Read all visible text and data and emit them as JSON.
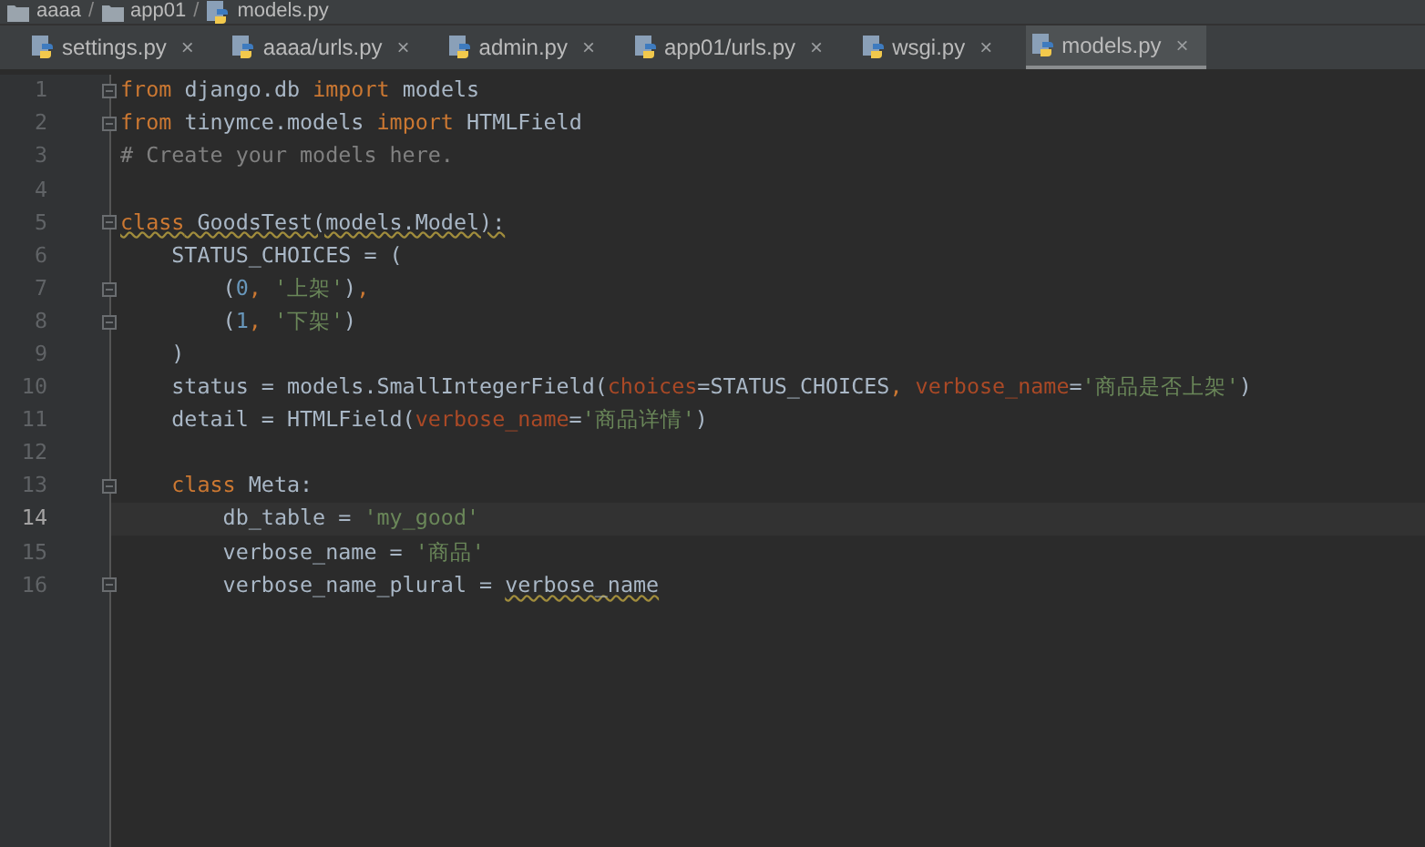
{
  "breadcrumbs": [
    {
      "label": "aaaa"
    },
    {
      "label": "app01"
    },
    {
      "label": "models.py"
    }
  ],
  "breadcrumb_separator": "/",
  "tabs": [
    {
      "label": "settings.py",
      "selected": false
    },
    {
      "label": "aaaa/urls.py",
      "selected": false
    },
    {
      "label": "admin.py",
      "selected": false
    },
    {
      "label": "app01/urls.py",
      "selected": false
    },
    {
      "label": "wsgi.py",
      "selected": false
    },
    {
      "label": "models.py",
      "selected": true
    }
  ],
  "close_glyph": "×",
  "lines": [
    {
      "number": "1",
      "current": false,
      "fold": true,
      "tokens": [
        {
          "text": "from",
          "kind": "keyword"
        },
        {
          "text": " django.db ",
          "kind": "plain"
        },
        {
          "text": "import",
          "kind": "keyword"
        },
        {
          "text": " models",
          "kind": "plain"
        }
      ]
    },
    {
      "number": "2",
      "current": false,
      "fold": true,
      "tokens": [
        {
          "text": "from",
          "kind": "keyword"
        },
        {
          "text": " tinymce.models ",
          "kind": "plain"
        },
        {
          "text": "import",
          "kind": "keyword"
        },
        {
          "text": " HTMLField",
          "kind": "plain"
        }
      ]
    },
    {
      "number": "3",
      "current": false,
      "fold": false,
      "tokens": [
        {
          "text": "# Create your models here.",
          "kind": "comment"
        }
      ]
    },
    {
      "number": "4",
      "current": false,
      "fold": false
    },
    {
      "number": "5",
      "current": false,
      "fold": true,
      "tokens": [
        {
          "text": "class",
          "kind": "keyword",
          "underlined": true
        },
        {
          "text": " GoodsTest(models.Model):",
          "kind": "plain",
          "underlined": true
        }
      ]
    },
    {
      "number": "6",
      "current": false,
      "fold": false,
      "tokens": [
        {
          "text": "    STATUS_CHOICES = (",
          "kind": "plain"
        }
      ]
    },
    {
      "number": "7",
      "current": false,
      "fold": true,
      "tokens": [
        {
          "text": "        (",
          "kind": "plain"
        },
        {
          "text": "0",
          "kind": "number"
        },
        {
          "text": ", ",
          "kind": "keyword"
        },
        {
          "text": "'上架'",
          "kind": "string"
        },
        {
          "text": ")",
          "kind": "plain"
        },
        {
          "text": ",",
          "kind": "keyword"
        }
      ]
    },
    {
      "number": "8",
      "current": false,
      "fold": true,
      "tokens": [
        {
          "text": "        (",
          "kind": "plain"
        },
        {
          "text": "1",
          "kind": "number"
        },
        {
          "text": ", ",
          "kind": "keyword"
        },
        {
          "text": "'下架'",
          "kind": "string"
        },
        {
          "text": ")",
          "kind": "plain"
        }
      ]
    },
    {
      "number": "9",
      "current": false,
      "fold": false,
      "tokens": [
        {
          "text": "    )",
          "kind": "plain"
        }
      ]
    },
    {
      "number": "10",
      "current": false,
      "fold": false,
      "tokens": [
        {
          "text": "    status = models.SmallIntegerField(",
          "kind": "plain"
        },
        {
          "text": "choices",
          "kind": "param"
        },
        {
          "text": "=STATUS_CHOICES",
          "kind": "plain"
        },
        {
          "text": ", ",
          "kind": "keyword"
        },
        {
          "text": "verbose_name",
          "kind": "param"
        },
        {
          "text": "=",
          "kind": "plain"
        },
        {
          "text": "'商品是否上架'",
          "kind": "string"
        },
        {
          "text": ")",
          "kind": "plain"
        }
      ]
    },
    {
      "number": "11",
      "current": false,
      "fold": false,
      "tokens": [
        {
          "text": "    detail = HTMLField(",
          "kind": "plain"
        },
        {
          "text": "verbose_name",
          "kind": "param"
        },
        {
          "text": "=",
          "kind": "plain"
        },
        {
          "text": "'商品详情'",
          "kind": "string"
        },
        {
          "text": ")",
          "kind": "plain"
        }
      ]
    },
    {
      "number": "12",
      "current": false,
      "fold": false
    },
    {
      "number": "13",
      "current": false,
      "fold": true,
      "tokens": [
        {
          "text": "    class",
          "kind": "keyword"
        },
        {
          "text": " Meta:",
          "kind": "plain"
        }
      ]
    },
    {
      "number": "14",
      "current": true,
      "fold": false,
      "tokens": [
        {
          "text": "        db_table = ",
          "kind": "plain"
        },
        {
          "text": "'my_good'",
          "kind": "string"
        }
      ]
    },
    {
      "number": "15",
      "current": false,
      "fold": false,
      "tokens": [
        {
          "text": "        verbose_name = ",
          "kind": "plain"
        },
        {
          "text": "'商品'",
          "kind": "string"
        }
      ]
    },
    {
      "number": "16",
      "current": false,
      "fold": true,
      "tokens": [
        {
          "text": "        verbose_name_plural = ",
          "kind": "plain"
        },
        {
          "text": "verbose_name",
          "kind": "plain",
          "underlined": true
        }
      ]
    }
  ]
}
